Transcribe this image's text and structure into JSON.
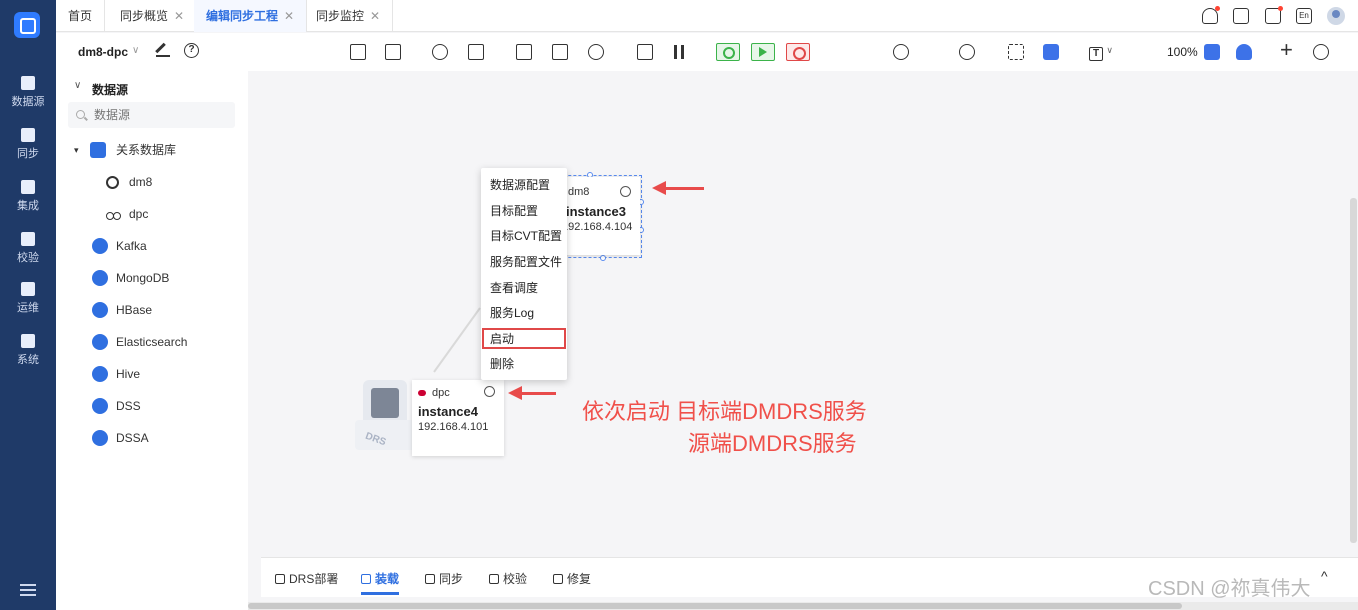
{
  "tabs": [
    {
      "label": "首页",
      "closable": false
    },
    {
      "label": "同步概览",
      "closable": true
    },
    {
      "label": "编辑同步工程",
      "closable": true,
      "active": true
    },
    {
      "label": "同步监控",
      "closable": true
    }
  ],
  "close_glyph": "✕",
  "header": {
    "lang_label": "En",
    "icons": [
      "bell-icon",
      "help-icon",
      "log-icon",
      "lang-icon",
      "avatar"
    ]
  },
  "rail": [
    {
      "label": "数据源",
      "icon": "datasource-icon"
    },
    {
      "label": "同步",
      "icon": "sync-icon"
    },
    {
      "label": "集成",
      "icon": "integration-icon"
    },
    {
      "label": "校验",
      "icon": "verify-icon"
    },
    {
      "label": "运维",
      "icon": "ops-icon"
    },
    {
      "label": "系统",
      "icon": "system-icon"
    }
  ],
  "sidebar": {
    "project": "dm8-dpc",
    "project_caret": "∨",
    "section_caret": "∨",
    "section_title": "数据源",
    "search_placeholder": "数据源",
    "tree_caret": "▾",
    "tree": [
      {
        "label": "关系数据库",
        "icon": "database-cube-icon"
      },
      {
        "label": "dm8",
        "icon": "dm8-icon"
      },
      {
        "label": "dpc",
        "icon": "dpc-cluster-icon"
      },
      {
        "label": "Kafka",
        "icon": "kafka-icon"
      },
      {
        "label": "MongoDB",
        "icon": "mongodb-icon"
      },
      {
        "label": "HBase",
        "icon": "hbase-icon"
      },
      {
        "label": "Elasticsearch",
        "icon": "elasticsearch-icon"
      },
      {
        "label": "Hive",
        "icon": "hive-icon"
      },
      {
        "label": "DSS",
        "icon": "dss-icon"
      },
      {
        "label": "DSSA",
        "icon": "dssa-icon"
      }
    ]
  },
  "toolbar": {
    "zoom": "100%",
    "text_mode": "T",
    "text_caret": "∨",
    "plus": "+"
  },
  "canvas": {
    "node_top": {
      "type": "dm8",
      "name": "instance3",
      "ip": "192.168.4.104"
    },
    "node_bottom": {
      "type": "dpc",
      "name": "instance4",
      "ip": "192.168.4.101"
    },
    "drs_label": "DRS",
    "context_menu": [
      "数据源配置",
      "目标配置",
      "目标CVT配置",
      "服务配置文件",
      "查看调度",
      "服务Log",
      "启动",
      "删除"
    ],
    "highlighted_item": "启动",
    "note_line1": "依次启动 目标端DMDRS服务",
    "note_line2": "源端DMDRS服务"
  },
  "bottom_tabs": [
    {
      "label": "DRS部署"
    },
    {
      "label": "装载",
      "active": true
    },
    {
      "label": "同步"
    },
    {
      "label": "校验"
    },
    {
      "label": "修复"
    }
  ],
  "bottom_collapse": "^",
  "watermark": "CSDN @祢真伟大",
  "colors": {
    "rail": "#1f3a68",
    "accent": "#2f6fe0",
    "annotation": "#f0504a"
  }
}
